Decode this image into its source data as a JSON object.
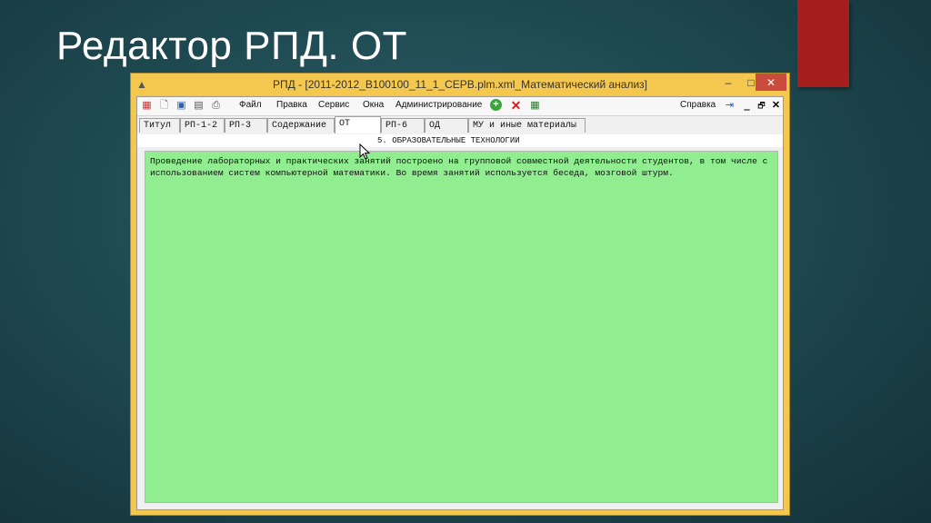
{
  "slide": {
    "title": "Редактор РПД. ОТ",
    "accent_color": "#a61d1d"
  },
  "window": {
    "title": "РПД - [2011-2012_В100100_11_1_СЕРВ.plm.xml_Математический анализ]",
    "app_icon": "app-icon",
    "controls": {
      "minimize": "–",
      "maximize": "□",
      "close": "✕"
    }
  },
  "toolbar": {
    "menus": [
      "Файл",
      "Правка",
      "Сервис",
      "Окна",
      "Администрирование"
    ],
    "help": "Справка",
    "mdi_controls": {
      "minimize": "‗",
      "restore": "🗗",
      "close": "✕"
    }
  },
  "tabs": [
    {
      "label": "Титул",
      "active": false
    },
    {
      "label": "РП-1-2",
      "active": false
    },
    {
      "label": "РП-3",
      "active": false
    },
    {
      "label": "Содержание",
      "active": false
    },
    {
      "label": "ОТ",
      "active": true
    },
    {
      "label": "РП-6",
      "active": false
    },
    {
      "label": "ОД",
      "active": false
    },
    {
      "label": "МУ и иные материалы",
      "active": false
    }
  ],
  "section": {
    "header": "5. ОБРАЗОВАТЕЛЬНЫЕ ТЕХНОЛОГИИ"
  },
  "editor": {
    "text": "Проведение лабораторных и практических занятий построено на групповой совместной деятельности студентов, в том числе с использованием систем компьютерной математики. Во время занятий используется беседа, мозговой штурм.",
    "background": "#90ee90"
  }
}
